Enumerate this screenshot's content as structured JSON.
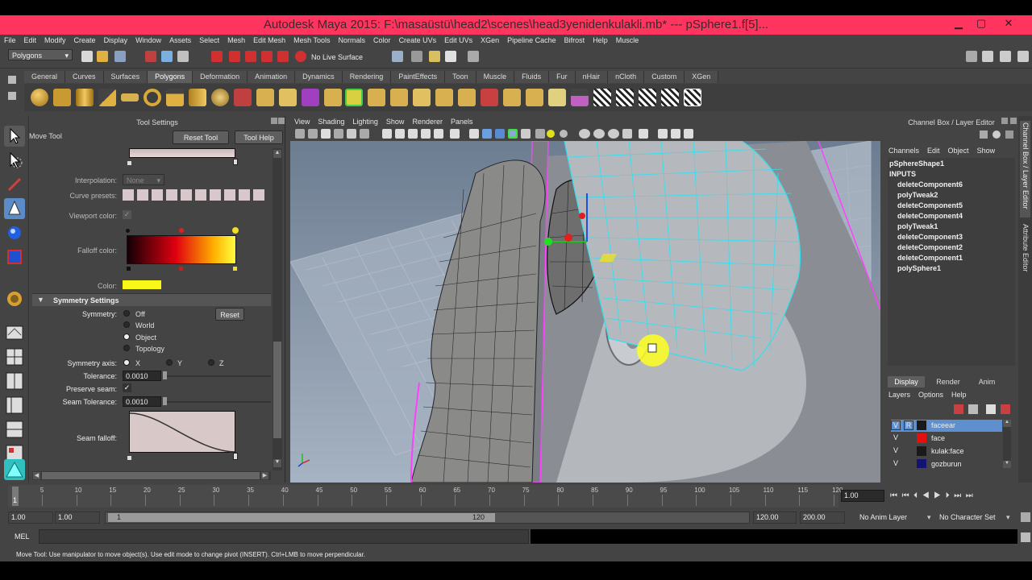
{
  "window": {
    "title": "Autodesk Maya 2015: F:\\masaüstü\\head2\\scenes\\head3yenidenkulakli.mb*   ---   pSphere1.f[5]...",
    "minimize": "▁",
    "maximize": "▢",
    "close": "✕"
  },
  "menubar": [
    "File",
    "Edit",
    "Modify",
    "Create",
    "Display",
    "Window",
    "Assets",
    "Select",
    "Mesh",
    "Edit Mesh",
    "Mesh Tools",
    "Normals",
    "Color",
    "Create UVs",
    "Edit UVs",
    "XGen",
    "Pipeline Cache",
    "Bifrost",
    "Help",
    "Muscle"
  ],
  "statusline": {
    "mode": "Polygons",
    "live_surface": "No Live Surface"
  },
  "shelf_tabs": [
    "General",
    "Curves",
    "Surfaces",
    "Polygons",
    "Deformation",
    "Animation",
    "Dynamics",
    "Rendering",
    "PaintEffects",
    "Toon",
    "Muscle",
    "Fluids",
    "Fur",
    "nHair",
    "nCloth",
    "Custom",
    "XGen"
  ],
  "shelf_active": "Polygons",
  "tool_settings": {
    "panel_title": "Tool Settings",
    "tool_name": "Move Tool",
    "reset_tool": "Reset Tool",
    "tool_help": "Tool Help",
    "interpolation_label": "Interpolation:",
    "interpolation_value": "None",
    "curve_presets_label": "Curve presets:",
    "viewport_color_label": "Viewport color:",
    "falloff_color_label": "Falloff color:",
    "color_label": "Color:",
    "symmetry_section": "Symmetry Settings",
    "symmetry_label": "Symmetry:",
    "symmetry_options": [
      "Off",
      "World",
      "Object",
      "Topology"
    ],
    "symmetry_selected": "Object",
    "reset": "Reset",
    "symmetry_axis_label": "Symmetry axis:",
    "axis_options": [
      "X",
      "Y",
      "Z"
    ],
    "tolerance_label": "Tolerance:",
    "tolerance_value": "0.0010",
    "preserve_seam_label": "Preserve seam:",
    "seam_tolerance_label": "Seam Tolerance:",
    "seam_tolerance_value": "0.0010",
    "seam_falloff_label": "Seam falloff:"
  },
  "viewport_menu": [
    "View",
    "Shading",
    "Lighting",
    "Show",
    "Renderer",
    "Panels"
  ],
  "channel_box": {
    "title": "Channel Box / Layer Editor",
    "menu": [
      "Channels",
      "Edit",
      "Object",
      "Show"
    ],
    "shape": "pSphereShape1",
    "inputs": "INPUTS",
    "history": [
      "deleteComponent6",
      "polyTweak2",
      "deleteComponent5",
      "deleteComponent4",
      "polyTweak1",
      "deleteComponent3",
      "deleteComponent2",
      "deleteComponent1",
      "polySphere1"
    ]
  },
  "side_tabs": [
    "Channel Box / Layer Editor",
    "Attribute Editor"
  ],
  "layer_editor": {
    "tabs": [
      "Display",
      "Render",
      "Anim"
    ],
    "menu": [
      "Layers",
      "Options",
      "Help"
    ],
    "layers": [
      {
        "v": "V",
        "r": "R",
        "name": "faceear",
        "color": "#1a1a1a",
        "selected": true
      },
      {
        "v": "V",
        "r": "",
        "name": "face",
        "color": "#e21010",
        "selected": false
      },
      {
        "v": "V",
        "r": "",
        "name": "kulak:face",
        "color": "#1a1a1a",
        "selected": false
      },
      {
        "v": "V",
        "r": "",
        "name": "gozburun",
        "color": "#141470",
        "selected": false
      }
    ]
  },
  "timeline": {
    "ticks": [
      "5",
      "10",
      "15",
      "20",
      "25",
      "30",
      "35",
      "40",
      "45",
      "50",
      "55",
      "60",
      "65",
      "70",
      "75",
      "80",
      "85",
      "90",
      "95",
      "100",
      "105",
      "110",
      "115",
      "120"
    ],
    "current_frame": "1",
    "current_frame_field": "1.00"
  },
  "range": {
    "start": "1.00",
    "start2": "1.00",
    "slider_start": "1",
    "slider_end": "120",
    "end": "120.00",
    "end2": "200.00",
    "anim_layer": "No Anim Layer",
    "char_set": "No Character Set"
  },
  "command_line": {
    "label": "MEL"
  },
  "help_line": "Move Tool: Use manipulator to move object(s). Use edit mode to change pivot (INSERT).  Ctrl+LMB to move perpendicular."
}
